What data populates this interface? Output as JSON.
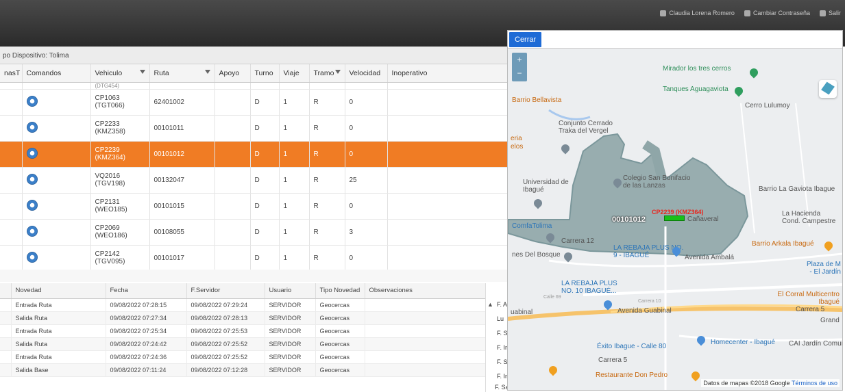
{
  "topbar": {
    "user": "Claudia Lorena Romero",
    "change_password": "Cambiar Contraseña",
    "logout": "Salir"
  },
  "subtitle": "po Dispositivo: Tolima",
  "grid": {
    "headers": [
      "nasT",
      "Comandos",
      "Vehiculo",
      "Ruta",
      "Apoyo",
      "Turno",
      "Viaje",
      "Tramo",
      "Velocidad",
      "Inoperativo"
    ],
    "partial_row": "(DTG454)",
    "rows": [
      {
        "vehicle": "CP1063",
        "plate": "(TGT066)",
        "route": "62401002",
        "turno": "D",
        "viaje": "1",
        "tramo": "R",
        "speed": "0"
      },
      {
        "vehicle": "CP2233",
        "plate": "(KMZ358)",
        "route": "00101011",
        "turno": "D",
        "viaje": "1",
        "tramo": "R",
        "speed": "0"
      },
      {
        "vehicle": "CP2239",
        "plate": "(KMZ364)",
        "route": "00101012",
        "turno": "D",
        "viaje": "1",
        "tramo": "R",
        "speed": "0"
      },
      {
        "vehicle": "VQ2016",
        "plate": "(TGV198)",
        "route": "00132047",
        "turno": "D",
        "viaje": "1",
        "tramo": "R",
        "speed": "25"
      },
      {
        "vehicle": "CP2131",
        "plate": "(WEO185)",
        "route": "00101015",
        "turno": "D",
        "viaje": "1",
        "tramo": "R",
        "speed": "0"
      },
      {
        "vehicle": "CP2069",
        "plate": "(WEO186)",
        "route": "00108055",
        "turno": "D",
        "viaje": "1",
        "tramo": "R",
        "speed": "3"
      },
      {
        "vehicle": "CP2142",
        "plate": "(TGV095)",
        "route": "00101017",
        "turno": "D",
        "viaje": "1",
        "tramo": "R",
        "speed": "0"
      }
    ]
  },
  "log": {
    "headers": [
      "Novedad",
      "Fecha",
      "F.Servidor",
      "Usuario",
      "Tipo Novedad",
      "Observaciones"
    ],
    "rows": [
      {
        "novedad": "Entrada Ruta",
        "fecha": "09/08/2022 07:28:15",
        "servidor": "09/08/2022 07:29:24",
        "usuario": "SERVIDOR",
        "tipo": "Geocercas"
      },
      {
        "novedad": "Salida Ruta",
        "fecha": "09/08/2022 07:27:34",
        "servidor": "09/08/2022 07:28:13",
        "usuario": "SERVIDOR",
        "tipo": "Geocercas"
      },
      {
        "novedad": "Entrada Ruta",
        "fecha": "09/08/2022 07:25:34",
        "servidor": "09/08/2022 07:25:53",
        "usuario": "SERVIDOR",
        "tipo": "Geocercas"
      },
      {
        "novedad": "Salida Ruta",
        "fecha": "09/08/2022 07:24:42",
        "servidor": "09/08/2022 07:25:52",
        "usuario": "SERVIDOR",
        "tipo": "Geocercas"
      },
      {
        "novedad": "Entrada Ruta",
        "fecha": "09/08/2022 07:24:36",
        "servidor": "09/08/2022 07:25:52",
        "usuario": "SERVIDOR",
        "tipo": "Geocercas"
      },
      {
        "novedad": "Salida Base",
        "fecha": "09/08/2022 07:11:24",
        "servidor": "09/08/2022 07:12:28",
        "usuario": "SERVIDOR",
        "tipo": "Geocercas"
      }
    ]
  },
  "side_panel": {
    "rows": [
      "F. A",
      "Lu",
      "F. S",
      "F. In",
      "F. S",
      "F. In"
    ],
    "last": "F. Salida DF"
  },
  "map": {
    "close": "Cerrar",
    "labels": {
      "mirador": "Mirador los tres cerros",
      "tanques": "Tanques Aguagaviota",
      "lulumoy": "Cerro Lulumoy",
      "bellavista": "Barrio Bellavista",
      "conjunto": "Conjunto Cerrado Traka del Vergel",
      "eria": "eria",
      "elos": "elos",
      "universidad": "Universidad de Ibagué",
      "colegio": "Colegio San Bonifacio de las Lanzas",
      "gaviota": "Barrio La Gaviota Ibague",
      "hacienda": "La Hacienda Cond. Campestre",
      "comfa": "ComfaTolima",
      "navera": "Cañaveral",
      "arkala": "Barrio Arkala Ibagué",
      "bosque": "nes Del Bosque",
      "rebaja9": "LA REBAJA PLUS NO. 9 - IBAGUÉ",
      "ambala": "Avenida Ambalá",
      "plaza": "Plaza de M - El Jardín",
      "rebaja10": "LA REBAJA PLUS NO. 10 IBAGUÉ...",
      "corral": "El Corral Multicentro Ibagué",
      "guabinal": "Avenida Guabinal",
      "guabinal2": "uabinal",
      "carrera5": "Carrera 5",
      "grand": "Grand",
      "exito": "Éxito Ibague - Calle 80",
      "homecenter": "Homecenter - Ibagué",
      "jardin": "CAI Jardín Comun",
      "restaurante": "Restaurante Don Pedro",
      "carrera12": "Carrera 12",
      "calle69": "Calle 69",
      "carrera10": "Carrera 10"
    },
    "vehicle_label": "CP2239 (KMZ364)",
    "route_label": "00101012",
    "attribution": "Datos de mapas ©2018 Google",
    "terms": "Términos de uso"
  }
}
